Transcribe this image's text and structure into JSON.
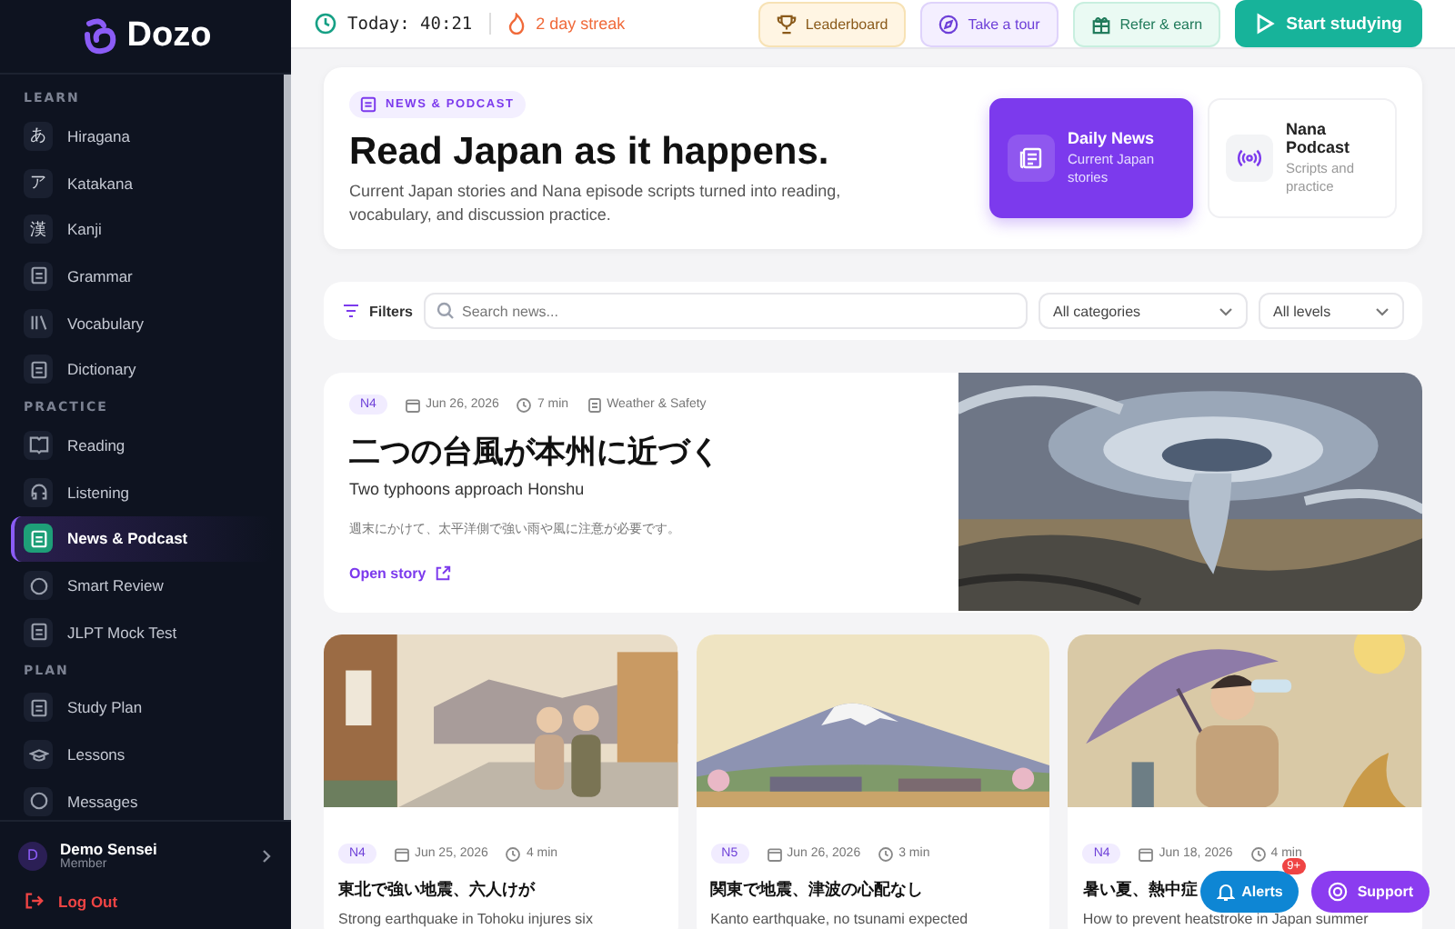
{
  "brand": "Dozo",
  "sidebar": {
    "sections": [
      {
        "label": "LEARN",
        "items": [
          {
            "label": "Hiragana",
            "icon": "あ",
            "kind": "glyph",
            "selected": false
          },
          {
            "label": "Katakana",
            "icon": "ア",
            "kind": "glyph",
            "selected": false
          },
          {
            "label": "Kanji",
            "icon": "漢",
            "kind": "glyph",
            "selected": false
          },
          {
            "label": "Grammar",
            "kind": "doc",
            "selected": false
          },
          {
            "label": "Vocabulary",
            "kind": "books",
            "selected": false
          },
          {
            "label": "Dictionary",
            "kind": "dict",
            "selected": false
          }
        ]
      },
      {
        "label": "PRACTICE",
        "items": [
          {
            "label": "Reading",
            "kind": "book",
            "selected": false
          },
          {
            "label": "Listening",
            "kind": "headphones",
            "selected": false
          },
          {
            "label": "News & Podcast",
            "kind": "news",
            "selected": true
          },
          {
            "label": "Smart Review",
            "kind": "brain",
            "selected": false
          },
          {
            "label": "JLPT Mock Test",
            "kind": "clipboard",
            "selected": false
          }
        ]
      },
      {
        "label": "PLAN",
        "items": [
          {
            "label": "Study Plan",
            "kind": "calendar",
            "selected": false
          },
          {
            "label": "Lessons",
            "kind": "cap",
            "selected": false
          },
          {
            "label": "Messages",
            "kind": "chat",
            "selected": false
          }
        ]
      }
    ],
    "user": {
      "initial": "D",
      "name": "Demo Sensei",
      "role": "Member"
    },
    "logout": "Log Out"
  },
  "topbar": {
    "today": "Today: 40:21",
    "streak": "2 day streak",
    "buttons": [
      {
        "label": "Leaderboard",
        "kind": "trophy"
      },
      {
        "label": "Take a tour",
        "kind": "compass"
      },
      {
        "label": "Refer & earn",
        "kind": "gift"
      }
    ],
    "primary": "Start studying"
  },
  "hero": {
    "tag": "NEWS & PODCAST",
    "title": "Read Japan as it happens.",
    "subtitle": "Current Japan stories and Nana episode scripts turned into reading, vocabulary, and discussion practice.",
    "modes": [
      {
        "title": "Daily News",
        "subtitle": "Current Japan stories",
        "kind": "news",
        "selected": true
      },
      {
        "title": "Nana Podcast",
        "subtitle": "Scripts and practice",
        "kind": "podcast",
        "selected": false
      }
    ]
  },
  "filters": {
    "label": "Filters",
    "search": {
      "placeholder": "Search news..."
    },
    "category": "All categories",
    "level": "All levels"
  },
  "featured": {
    "level": "N4",
    "date": "Jun 26, 2026",
    "duration": "7 min",
    "category": "Weather & Safety",
    "title": "二つの台風が本州に近づく",
    "english": "Two typhoons approach Honshu",
    "summary": "週末にかけて、太平洋側で強い雨や風に注意が必要です。",
    "link": "Open story",
    "kind": "picture"
  },
  "stories": [
    {
      "level": "N4",
      "date": "Jun 25, 2026",
      "duration": "4 min",
      "title": "東北で強い地震、六人けが",
      "english": "Strong earthquake in Tohoku injures six",
      "kind": "picture"
    },
    {
      "level": "N5",
      "date": "Jun 26, 2026",
      "duration": "3 min",
      "title": "関東で地震、津波の心配なし",
      "english": "Kanto earthquake, no tsunami expected",
      "kind": "picture"
    },
    {
      "level": "N4",
      "date": "Jun 18, 2026",
      "duration": "4 min",
      "title": "暑い夏、熱中症",
      "english": "How to prevent heatstroke in Japan summer",
      "kind": "picture"
    }
  ],
  "floating": {
    "alerts": "Alerts",
    "alerts_count": "9+",
    "support": "Support"
  }
}
